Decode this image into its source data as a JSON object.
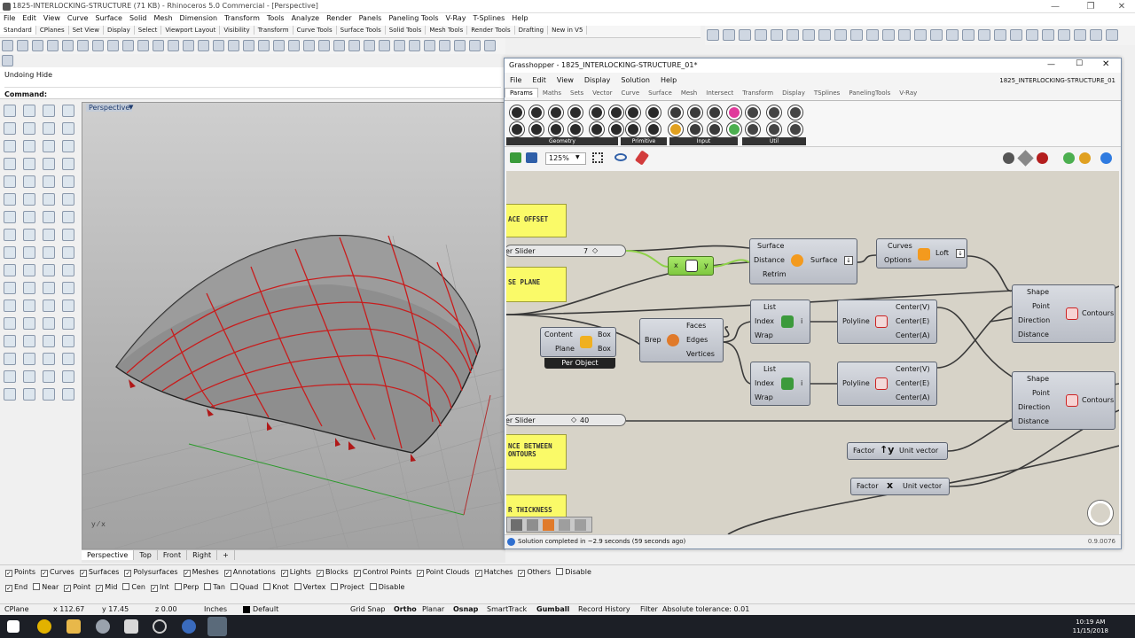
{
  "rhino": {
    "title": "1825-INTERLOCKING-STRUCTURE (71 KB) - Rhinoceros 5.0 Commercial - [Perspective]",
    "menu": [
      "File",
      "Edit",
      "View",
      "Curve",
      "Surface",
      "Solid",
      "Mesh",
      "Dimension",
      "Transform",
      "Tools",
      "Analyze",
      "Render",
      "Panels",
      "Paneling Tools",
      "V-Ray",
      "T-Splines",
      "Help"
    ],
    "toolbar_tabs": [
      "Standard",
      "CPlanes",
      "Set View",
      "Display",
      "Select",
      "Viewport Layout",
      "Visibility",
      "Transform",
      "Curve Tools",
      "Surface Tools",
      "Solid Tools",
      "Mesh Tools",
      "Render Tools",
      "Drafting",
      "New in V5"
    ],
    "command_history": "Undoing Hide",
    "command_prompt": "Command:",
    "viewport_label": "Perspective",
    "viewport_tabs": [
      "Perspective",
      "Top",
      "Front",
      "Right"
    ],
    "object_filters": [
      "Points",
      "Curves",
      "Surfaces",
      "Polysurfaces",
      "Meshes",
      "Annotations",
      "Lights",
      "Blocks",
      "Control Points",
      "Point Clouds",
      "Hatches",
      "Others",
      "Disable"
    ],
    "object_filters_checked": [
      true,
      true,
      true,
      true,
      true,
      true,
      true,
      true,
      true,
      true,
      true,
      true,
      false
    ],
    "osnaps": [
      "End",
      "Near",
      "Point",
      "Mid",
      "Cen",
      "Int",
      "Perp",
      "Tan",
      "Quad",
      "Knot",
      "Vertex",
      "Project",
      "Disable"
    ],
    "osnaps_checked": [
      true,
      false,
      true,
      true,
      false,
      true,
      false,
      false,
      false,
      false,
      false,
      false,
      false
    ],
    "status": {
      "cplane": "CPlane",
      "x": "x 112.67",
      "y": "y 17.45",
      "z": "z 0.00",
      "units": "Inches",
      "layer": "Default",
      "toggles": [
        "Grid Snap",
        "Ortho",
        "Planar",
        "Osnap",
        "SmartTrack",
        "Gumball",
        "Record History",
        "Filter"
      ],
      "tolerance": "Absolute tolerance: 0.01"
    },
    "clock": {
      "time": "10:19 AM",
      "date": "11/15/2018"
    }
  },
  "grasshopper": {
    "title": "Grasshopper - 1825_INTERLOCKING-STRUCTURE_01*",
    "doc_name": "1825_INTERLOCKING-STRUCTURE_01",
    "menu": [
      "File",
      "Edit",
      "View",
      "Display",
      "Solution",
      "Help"
    ],
    "tabs": [
      "Params",
      "Maths",
      "Sets",
      "Vector",
      "Curve",
      "Surface",
      "Mesh",
      "Intersect",
      "Transform",
      "Display",
      "TSplines",
      "PanelingTools",
      "V-Ray"
    ],
    "panels": [
      "Geometry",
      "Primitive",
      "Input",
      "Util"
    ],
    "zoom": "125%",
    "status_text": "Solution completed in ~2.9 seconds (59 seconds ago)",
    "version": "0.9.0076",
    "canvas": {
      "panel_offset": "ACE OFFSET",
      "panel_base": "SE PLANE",
      "panel_distance": "NCE BETWEEN\nONTOURS",
      "panel_thickness": "R THICKNESS",
      "slider1": {
        "label": "er Slider",
        "value": "7"
      },
      "slider2": {
        "label": "er Slider",
        "value": "40"
      },
      "offset_node": {
        "in": [
          "Surface",
          "Distance",
          "Retrim"
        ],
        "out": "Surface"
      },
      "loft_node": {
        "in": [
          "Curves",
          "Options"
        ],
        "name": "Loft"
      },
      "expr_node": {
        "x": "x",
        "y": "y"
      },
      "content_node": {
        "in": [
          "Content",
          "Plane"
        ],
        "out": [
          "Box",
          "Box"
        ],
        "badge": "Per Object"
      },
      "brep_node": {
        "in": "Brep",
        "out": [
          "Faces",
          "Edges",
          "Vertices"
        ]
      },
      "item1": {
        "in": [
          "List",
          "Index",
          "Wrap"
        ],
        "out": "i"
      },
      "item2": {
        "in": [
          "List",
          "Index",
          "Wrap"
        ],
        "out": "i"
      },
      "poly1": {
        "in": "Polyline",
        "out": [
          "Center(V)",
          "Center(E)",
          "Center(A)"
        ]
      },
      "poly2": {
        "in": "Polyline",
        "out": [
          "Center(V)",
          "Center(E)",
          "Center(A)"
        ]
      },
      "contour1": {
        "in": [
          "Shape",
          "Point",
          "Direction",
          "Distance"
        ],
        "name": "Contours"
      },
      "contour2": {
        "in": [
          "Shape",
          "Point",
          "Direction",
          "Distance"
        ],
        "name": "Contours"
      },
      "unit_y": {
        "in": "Factor",
        "out": "Unit vector"
      },
      "unit_x": {
        "in": "Factor",
        "out": "Unit vector"
      }
    }
  }
}
